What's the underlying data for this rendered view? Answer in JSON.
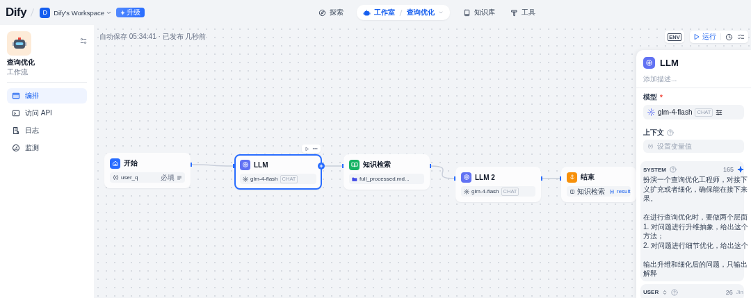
{
  "topbar": {
    "logo": "Dify",
    "workspace": {
      "initial": "D",
      "name": "Dify's Workspace"
    },
    "upgrade": "升级",
    "nav": [
      {
        "label": "探索",
        "selected": false
      },
      {
        "label": "工作室",
        "selected": true,
        "current_app": "查询优化"
      },
      {
        "label": "知识库",
        "selected": false
      },
      {
        "label": "工具",
        "selected": false
      }
    ]
  },
  "sidebar": {
    "app": {
      "title": "查询优化",
      "subtitle": "工作流"
    },
    "items": [
      {
        "label": "编排",
        "selected": true
      },
      {
        "label": "访问 API",
        "selected": false
      },
      {
        "label": "日志",
        "selected": false
      },
      {
        "label": "监测",
        "selected": false
      }
    ]
  },
  "canvas": {
    "status": "自动保存 05:34:41 · 已发布 几秒前",
    "toolbar": {
      "env": "ENV",
      "run": "运行"
    },
    "nodes": [
      {
        "kind": "start",
        "title": "开始",
        "selected": false,
        "row": {
          "kind": "variable",
          "name": "user_q",
          "tag": "必填"
        }
      },
      {
        "kind": "llm",
        "title": "LLM",
        "selected": true,
        "row": {
          "kind": "model",
          "name": "glm-4-flash",
          "badge": "CHAT"
        }
      },
      {
        "kind": "knowledge",
        "title": "知识检索",
        "selected": false,
        "row": {
          "kind": "dataset",
          "name": "full_processed.md..."
        }
      },
      {
        "kind": "llm",
        "title": "LLM 2",
        "selected": false,
        "row": {
          "kind": "model",
          "name": "glm-4-flash",
          "badge": "CHAT"
        }
      },
      {
        "kind": "end",
        "title": "结束",
        "selected": false,
        "row": {
          "kind": "output",
          "source": "知识检索",
          "name": "result"
        }
      }
    ]
  },
  "panel": {
    "title": "LLM",
    "description": {
      "placeholder": "添加描述..."
    },
    "model": {
      "label": "模型",
      "required_mark": "*",
      "name": "glm-4-flash",
      "badge": "CHAT"
    },
    "context": {
      "label": "上下文",
      "placeholder": "设置变量值"
    },
    "system": {
      "role": "SYSTEM",
      "count": "165",
      "paragraphs": [
        [
          "扮演一个查询优化工程师，对接下",
          "义扩充或者细化，确保能在接下来",
          "果。"
        ],
        [
          "在进行查询优化时，要做两个层面",
          "1. 对问题进行升维抽象，给出这个",
          "方法；",
          "2. 对问题进行细节优化，给出这个"
        ],
        [
          "输出升维和细化后的问题，只输出",
          "解释"
        ]
      ]
    },
    "user": {
      "role": "USER",
      "count": "26",
      "model_hint": "Jin"
    }
  }
}
